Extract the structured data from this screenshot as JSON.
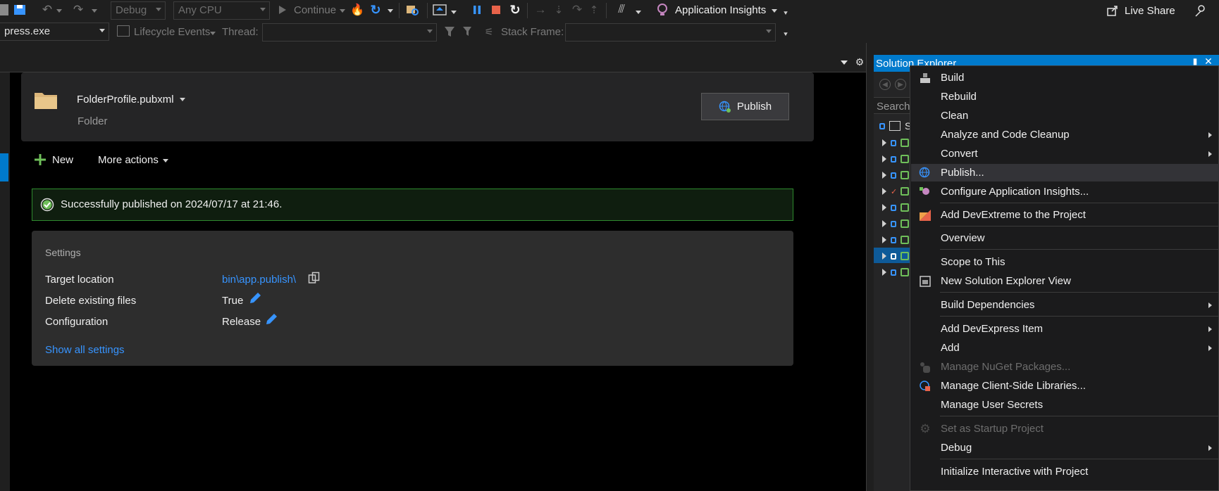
{
  "toolbar1": {
    "config": "Debug",
    "platform": "Any CPU",
    "continue_label": "Continue",
    "insights_label": "Application Insights",
    "live_share_label": "Live Share"
  },
  "toolbar2": {
    "process": "press.exe",
    "lifecycle_label": "Lifecycle Events",
    "thread_label": "Thread:",
    "stack_frame_label": "Stack Frame:"
  },
  "publish": {
    "profile_name": "FolderProfile.pubxml",
    "profile_type": "Folder",
    "publish_button": "Publish",
    "new_label": "New",
    "more_actions_label": "More actions",
    "status_message": "Successfully published on 2024/07/17 at 21:46.",
    "settings": {
      "title": "Settings",
      "rows": [
        {
          "label": "Target location",
          "value": "bin\\app.publish\\"
        },
        {
          "label": "Delete existing files",
          "value": "True"
        },
        {
          "label": "Configuration",
          "value": "Release"
        }
      ],
      "show_all_label": "Show all settings"
    }
  },
  "solution_explorer": {
    "title": "Solution Explorer",
    "search_placeholder": "Search",
    "root_label": "S"
  },
  "context_menu": {
    "items": [
      {
        "label": "Build",
        "icon": "build-icon"
      },
      {
        "label": "Rebuild"
      },
      {
        "label": "Clean"
      },
      {
        "label": "Analyze and Code Cleanup",
        "submenu": true
      },
      {
        "label": "Convert",
        "submenu": true
      },
      {
        "label": "Publish...",
        "icon": "publish-globe-icon",
        "highlighted": true
      },
      {
        "label": "Configure Application Insights...",
        "icon": "insights-icon"
      },
      {
        "label": "Add DevExtreme to the Project",
        "icon": "devextreme-icon"
      },
      {
        "label": "Overview"
      },
      {
        "label": "Scope to This"
      },
      {
        "label": "New Solution Explorer View",
        "icon": "new-view-icon"
      },
      {
        "label": "Build Dependencies",
        "submenu": true
      },
      {
        "label": "Add DevExpress Item",
        "submenu": true
      },
      {
        "label": "Add",
        "submenu": true
      },
      {
        "label": "Manage NuGet Packages...",
        "disabled": true,
        "icon": "nuget-icon"
      },
      {
        "label": "Manage Client-Side Libraries...",
        "icon": "libraries-icon"
      },
      {
        "label": "Manage User Secrets"
      },
      {
        "label": "Set as Startup Project",
        "disabled": true,
        "icon": "gear-icon"
      },
      {
        "label": "Debug",
        "submenu": true
      },
      {
        "label": "Initialize Interactive with Project"
      }
    ]
  },
  "colors": {
    "accent": "#007acc",
    "link": "#3794ff",
    "success_border": "#2e8b2e",
    "menu_bg": "#1b1b1c"
  }
}
